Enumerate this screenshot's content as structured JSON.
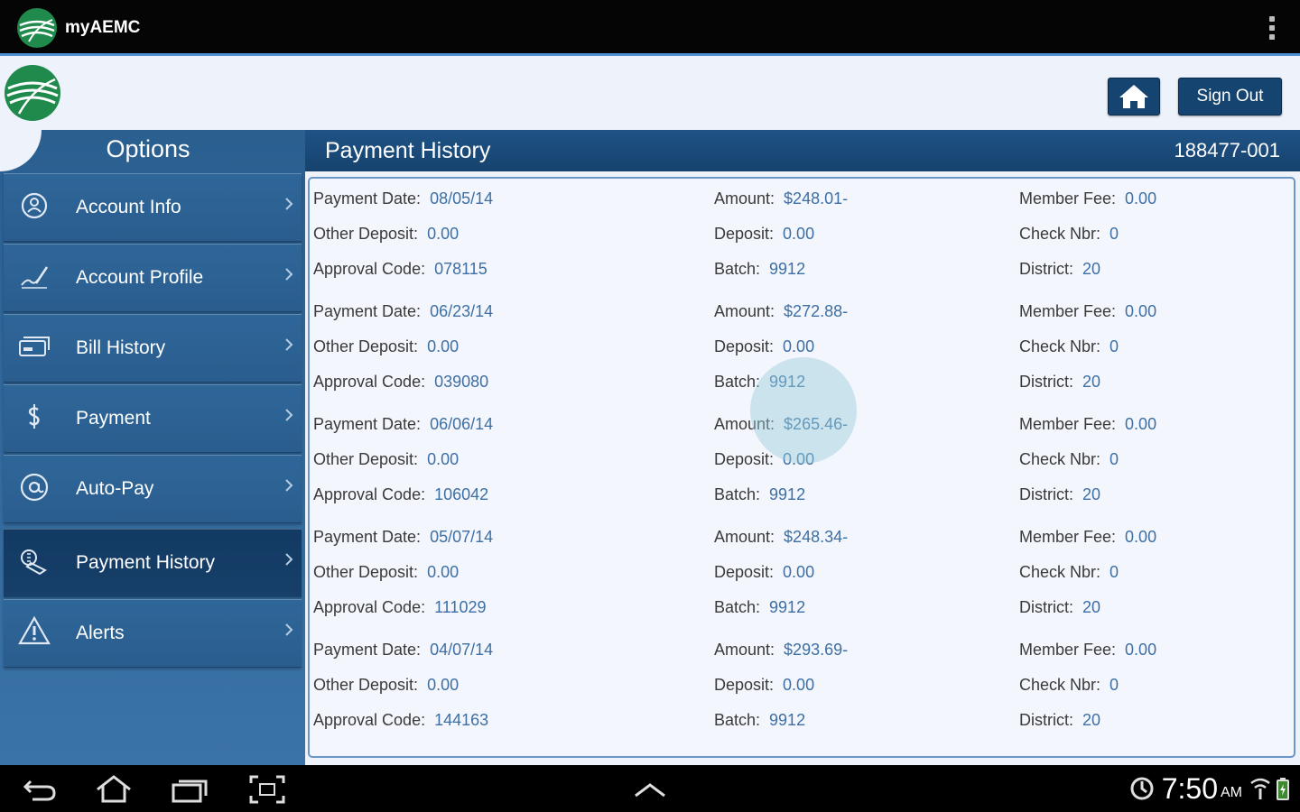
{
  "app": {
    "title": "myAEMC"
  },
  "header": {
    "signout_label": "Sign Out",
    "home_icon": "home-icon"
  },
  "sidebar": {
    "title": "Options",
    "items": [
      {
        "label": "Account Info",
        "icon": "user-circle-icon",
        "active": false
      },
      {
        "label": "Account Profile",
        "icon": "signature-icon",
        "active": false
      },
      {
        "label": "Bill History",
        "icon": "bill-stack-icon",
        "active": false
      },
      {
        "label": "Payment",
        "icon": "dollar-icon",
        "active": false
      },
      {
        "label": "Auto-Pay",
        "icon": "at-sign-icon",
        "active": false
      },
      {
        "label": "Payment History",
        "icon": "money-stack-icon",
        "active": true
      },
      {
        "label": "Alerts",
        "icon": "warning-icon",
        "active": false
      }
    ]
  },
  "content": {
    "title": "Payment History",
    "account_number": "188477-001",
    "labels": {
      "payment_date": "Payment Date:",
      "amount": "Amount:",
      "member_fee": "Member Fee:",
      "other_deposit": "Other Deposit:",
      "deposit": "Deposit:",
      "check_nbr": "Check Nbr:",
      "approval_code": "Approval Code:",
      "batch": "Batch:",
      "district": "District:"
    },
    "records": [
      {
        "payment_date": "08/05/14",
        "amount": "$248.01-",
        "member_fee": "0.00",
        "other_deposit": "0.00",
        "deposit": "0.00",
        "check_nbr": "0",
        "approval_code": "078115",
        "batch": "9912",
        "district": "20"
      },
      {
        "payment_date": "06/23/14",
        "amount": "$272.88-",
        "member_fee": "0.00",
        "other_deposit": "0.00",
        "deposit": "0.00",
        "check_nbr": "0",
        "approval_code": "039080",
        "batch": "9912",
        "district": "20"
      },
      {
        "payment_date": "06/06/14",
        "amount": "$265.46-",
        "member_fee": "0.00",
        "other_deposit": "0.00",
        "deposit": "0.00",
        "check_nbr": "0",
        "approval_code": "106042",
        "batch": "9912",
        "district": "20"
      },
      {
        "payment_date": "05/07/14",
        "amount": "$248.34-",
        "member_fee": "0.00",
        "other_deposit": "0.00",
        "deposit": "0.00",
        "check_nbr": "0",
        "approval_code": "111029",
        "batch": "9912",
        "district": "20"
      },
      {
        "payment_date": "04/07/14",
        "amount": "$293.69-",
        "member_fee": "0.00",
        "other_deposit": "0.00",
        "deposit": "0.00",
        "check_nbr": "0",
        "approval_code": "144163",
        "batch": "9912",
        "district": "20"
      }
    ]
  },
  "system_bar": {
    "time": "7:50",
    "ampm": "AM",
    "buttons": [
      "back-icon",
      "home-nav-icon",
      "recent-apps-icon",
      "screenshot-icon",
      "up-chevron-icon"
    ]
  },
  "colors": {
    "accent": "#14446f",
    "sidebar": "#2f6699",
    "value_text": "#3d6fa4",
    "logo_green": "#1f8a4c"
  }
}
